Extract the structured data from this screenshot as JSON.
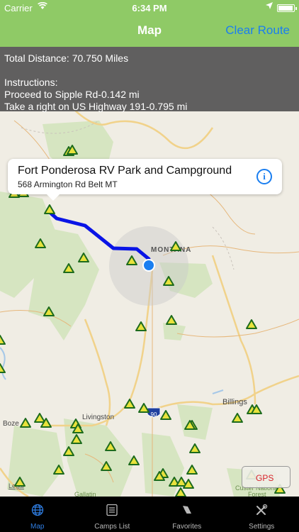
{
  "status_bar": {
    "carrier": "Carrier",
    "time": "6:34 PM",
    "battery_level": 0.95
  },
  "nav": {
    "title": "Map",
    "right_button": "Clear Route"
  },
  "route_panel": {
    "total_distance": "Total Distance: 70.750 Miles",
    "instructions_heading": "Instructions:",
    "steps": [
      "Proceed to Sipple Rd-0.142 mi",
      "Take a right on US Highway 191-0.795 mi"
    ]
  },
  "callout": {
    "title": "Fort Ponderosa RV Park and Campground",
    "subtitle": "568 Armington Rd Belt MT",
    "info_icon": "info-icon"
  },
  "map": {
    "labels": {
      "state": "MONTANA",
      "billings": "Billings",
      "livingston": "Livingston",
      "bozeman": "Boze",
      "interstate": "90",
      "custer": "Custer National",
      "forest": "Forest",
      "gallatin": "Gallatin",
      "legal": "Legal"
    },
    "colors": {
      "route": "#0a14e6",
      "campsite_fill": "#e8e23c",
      "campsite_border": "#1d6b1d",
      "user_location": "#1a7ef0",
      "forest": "#d7e6c1",
      "water": "#a6c8e8"
    }
  },
  "gps_button": {
    "label": "GPS"
  },
  "tabs": [
    {
      "label": "Map",
      "icon": "globe-icon",
      "active": true
    },
    {
      "label": "Camps List",
      "icon": "list-icon",
      "active": false
    },
    {
      "label": "Favorites",
      "icon": "tent-icon",
      "active": false
    },
    {
      "label": "Settings",
      "icon": "tools-icon",
      "active": false
    }
  ]
}
